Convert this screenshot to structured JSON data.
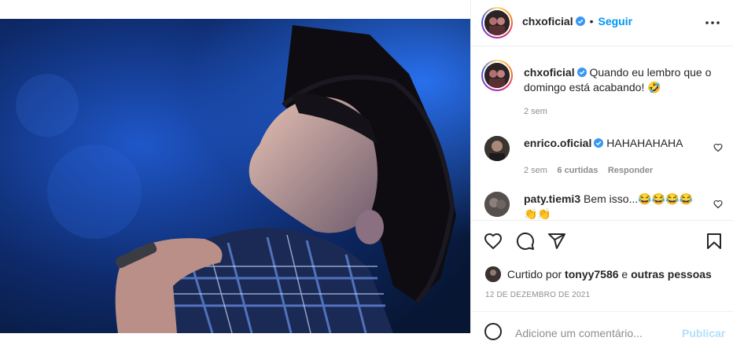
{
  "post": {
    "author": "chxoficial",
    "follow_label": "Seguir",
    "separator": "•",
    "more_label": "•••",
    "caption": "Quando eu lembro que o domingo está acabando! 🤣",
    "caption_age": "2 sem"
  },
  "comments": [
    {
      "user": "enrico.oficial",
      "verified": true,
      "text": "HAHAHAHAHA",
      "age": "2 sem",
      "likes": "6 curtidas",
      "reply_label": "Responder"
    },
    {
      "user": "paty.tiemi3",
      "verified": false,
      "text": "Bem isso...😂😂😂😂",
      "extra": "👏👏"
    }
  ],
  "likes": {
    "prefix": "Curtido por",
    "user": "tonyy7586",
    "joiner": "e",
    "suffix": "outras pessoas"
  },
  "date": "12 DE DEZEMBRO DE 2021",
  "add_comment": {
    "placeholder": "Adicione um comentário...",
    "publish_label": "Publicar"
  },
  "colors": {
    "link": "#0095f6",
    "verified": "#3897f0",
    "text": "#262626",
    "muted": "#8e8e8e",
    "border": "#efefef"
  },
  "icons": [
    "heart-icon",
    "comment-icon",
    "share-icon",
    "bookmark-icon",
    "emoji-icon",
    "verified-badge-icon"
  ]
}
